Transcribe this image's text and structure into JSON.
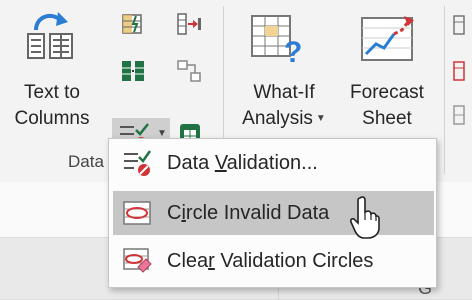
{
  "ribbon": {
    "text_to_columns": {
      "line1": "Text to",
      "line2": "Columns"
    },
    "what_if": {
      "line1": "What-If",
      "line2": "Analysis"
    },
    "forecast": {
      "line1": "Forecast",
      "line2": "Sheet"
    },
    "group_label": "Data",
    "icons": [
      "text-to-columns-icon",
      "flash-fill-icon",
      "remove-duplicates-icon",
      "consolidate-icon",
      "relationships-icon",
      "data-validation-icon",
      "manage-data-model-icon",
      "what-if-analysis-icon",
      "forecast-sheet-icon"
    ]
  },
  "menu": {
    "items": [
      {
        "pre": "Data ",
        "key": "V",
        "post": "alidation...",
        "icon": "data-validation-icon",
        "highlighted": false
      },
      {
        "pre": "C",
        "key": "i",
        "post": "rcle Invalid Data",
        "icon": "circle-invalid-data-icon",
        "highlighted": true
      },
      {
        "pre": "Clea",
        "key": "r",
        "post": " Validation Circles",
        "icon": "clear-validation-circles-icon",
        "highlighted": false
      }
    ]
  },
  "sheet": {
    "column_letter": "G"
  },
  "colors": {
    "accent_green": "#217346",
    "menu_highlight": "#c6c6c6",
    "validation_red": "#d13438"
  }
}
